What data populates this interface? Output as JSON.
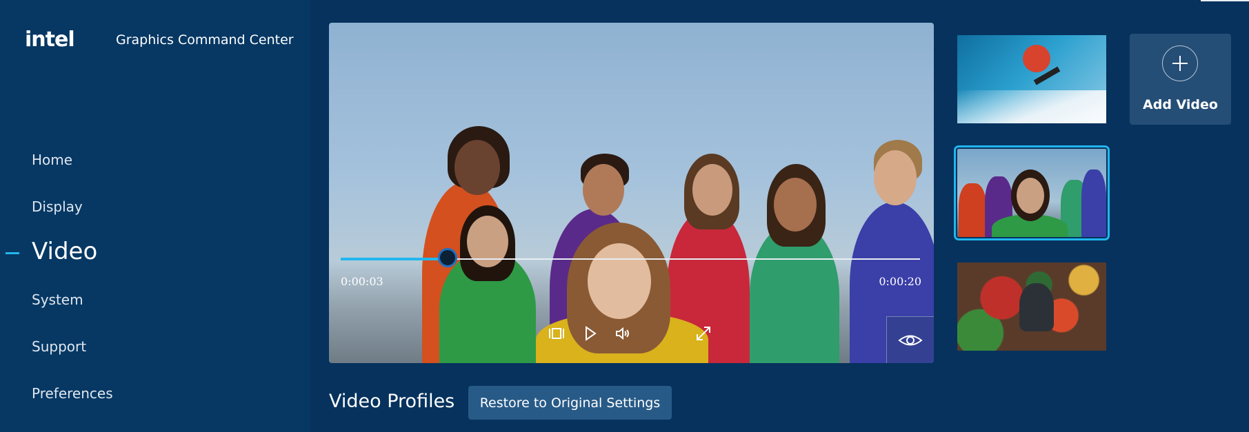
{
  "app": {
    "logo_text": "intel",
    "title": "Graphics Command Center"
  },
  "sidebar": {
    "items": [
      {
        "label": "Home",
        "active": false
      },
      {
        "label": "Display",
        "active": false
      },
      {
        "label": "Video",
        "active": true
      },
      {
        "label": "System",
        "active": false
      },
      {
        "label": "Support",
        "active": false
      },
      {
        "label": "Preferences",
        "active": false
      }
    ]
  },
  "player": {
    "current_time": "0:00:03",
    "duration": "0:00:20",
    "progress_fraction": 0.15,
    "controls": [
      "crop-icon",
      "play-icon",
      "volume-icon",
      "fullscreen-icon",
      "eye-icon"
    ]
  },
  "thumbnails": [
    {
      "subject": "snowboarder",
      "selected": false
    },
    {
      "subject": "group-of-friends",
      "selected": true
    },
    {
      "subject": "market-vendor",
      "selected": false
    }
  ],
  "add_video": {
    "label": "Add Video",
    "icon": "plus-icon"
  },
  "profiles": {
    "section_title": "Video Profiles",
    "restore_label": "Restore to Original Settings"
  },
  "colors": {
    "background": "#06325d",
    "sidebar": "#073864",
    "accent": "#22b6ee",
    "button": "#275a87"
  }
}
